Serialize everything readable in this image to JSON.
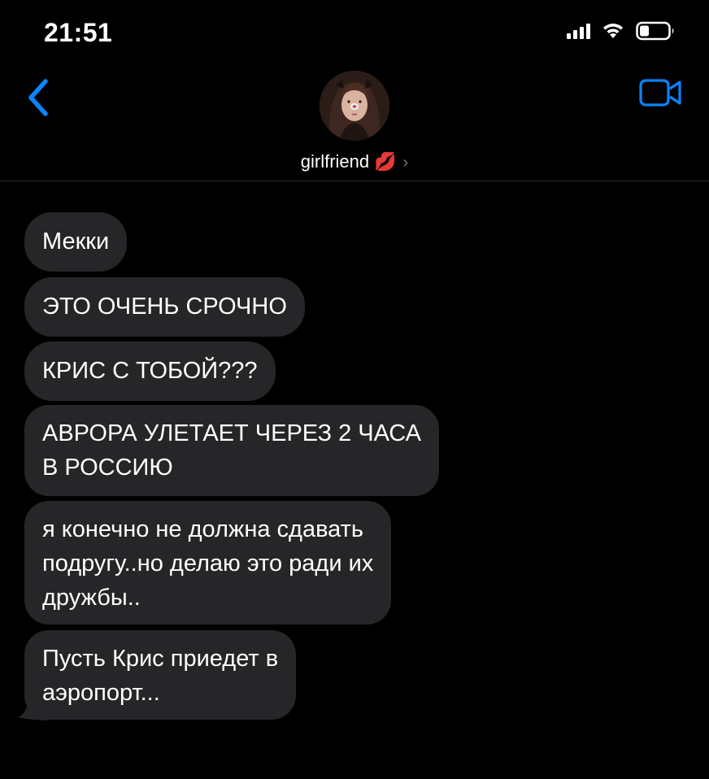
{
  "status_bar": {
    "time": "21:51",
    "icons": [
      "signal-icon",
      "wifi-icon",
      "battery-icon"
    ]
  },
  "header": {
    "back_icon": "chevron-left-icon",
    "contact_name": "girlfriend",
    "contact_emoji": "💋",
    "video_icon": "video-camera-icon"
  },
  "messages": [
    {
      "text": "Мекки"
    },
    {
      "text": "ЭТО ОЧЕНЬ СРОЧНО"
    },
    {
      "text": "КРИС С ТОБОЙ???"
    },
    {
      "text": "АВРОРА УЛЕТАЕТ ЧЕРЕЗ 2 ЧАСА\nВ РОССИЮ"
    },
    {
      "text": "я конечно не должна сдавать\nподругу..но делаю это ради их\nдружбы.."
    },
    {
      "text": "Пусть Крис приедет в\nаэропорт..."
    }
  ],
  "colors": {
    "background": "#000000",
    "bubble": "#262629",
    "accent": "#0a84ff"
  }
}
